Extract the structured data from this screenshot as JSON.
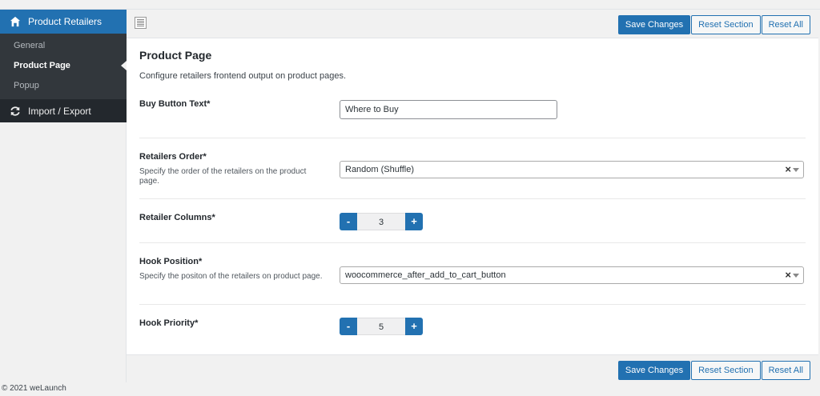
{
  "sidebar": {
    "header_label": "Product Retailers",
    "sub_items": [
      "General",
      "Product Page",
      "Popup"
    ],
    "active_item": "Product Page",
    "import_export_label": "Import / Export"
  },
  "toolbar": {
    "save_label": "Save Changes",
    "reset_section_label": "Reset Section",
    "reset_all_label": "Reset All"
  },
  "section": {
    "title": "Product Page",
    "description": "Configure retailers frontend output on product pages."
  },
  "fields": {
    "buy_button": {
      "label": "Buy Button Text*",
      "value": "Where to Buy"
    },
    "retailers_order": {
      "label": "Retailers Order*",
      "description": "Specify the order of the retailers on the product page.",
      "value": "Random (Shuffle)"
    },
    "retailer_columns": {
      "label": "Retailer Columns*",
      "value": "3"
    },
    "hook_position": {
      "label": "Hook Position*",
      "description": "Specify the positon of the retailers on product page.",
      "value": "woocommerce_after_add_to_cart_button"
    },
    "hook_priority": {
      "label": "Hook Priority*",
      "value": "5"
    }
  },
  "stepper": {
    "minus": "-",
    "plus": "+"
  },
  "select_clear": "×",
  "footer_text": "© 2021 weLaunch",
  "colors": {
    "accent": "#2271b1",
    "nav_bg": "#23282d",
    "sub_bg": "#32373c"
  },
  "icons": {
    "home": "home-icon",
    "sync": "sync-icon",
    "expand": "expand-icon"
  }
}
